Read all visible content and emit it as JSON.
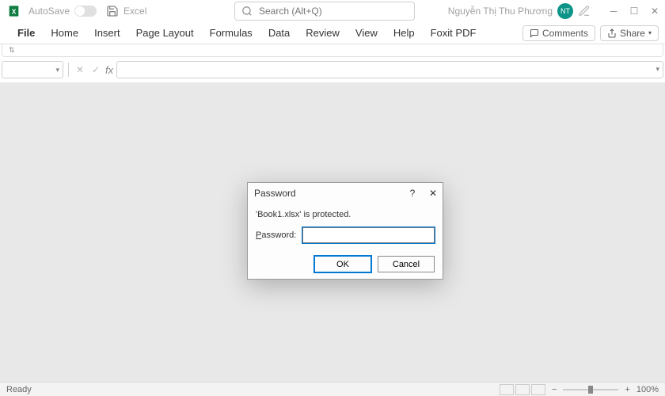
{
  "titlebar": {
    "autosave_label": "AutoSave",
    "app_name": "Excel",
    "search_placeholder": "Search (Alt+Q)",
    "user_name": "Nguyễn Thị Thu Phương",
    "user_initials": "NT"
  },
  "ribbon": {
    "tabs": [
      "File",
      "Home",
      "Insert",
      "Page Layout",
      "Formulas",
      "Data",
      "Review",
      "View",
      "Help",
      "Foxit PDF"
    ],
    "comments_label": "Comments",
    "share_label": "Share"
  },
  "formula_bar": {
    "fx_label": "fx"
  },
  "dialog": {
    "title": "Password",
    "message": "'Book1.xlsx' is protected.",
    "field_label": "Password:",
    "field_underline": "P",
    "field_rest": "assword:",
    "ok_label": "OK",
    "cancel_label": "Cancel"
  },
  "statusbar": {
    "ready": "Ready",
    "zoom": "100%"
  }
}
